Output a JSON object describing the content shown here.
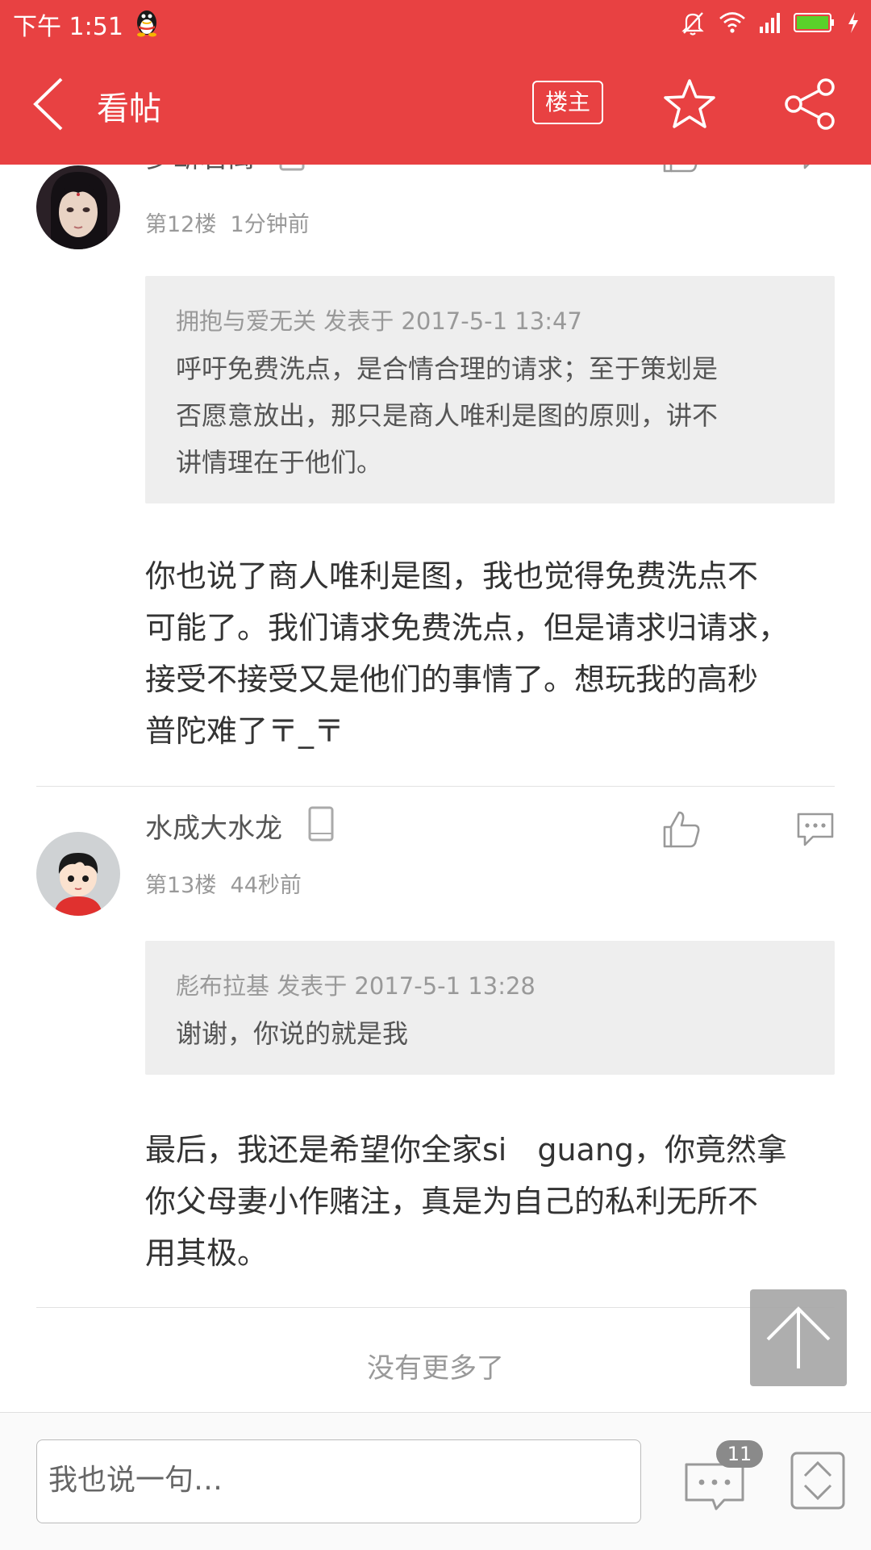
{
  "status_bar": {
    "time": "下午 1:51",
    "icons": [
      "qq-icon",
      "bell-off-icon",
      "wifi-icon",
      "signal-icon",
      "battery-icon",
      "charging-icon"
    ],
    "battery_color": "#5ad12a"
  },
  "app_bar": {
    "title": "看帖",
    "op_label": "楼主",
    "bg_color": "#e84142",
    "icons": [
      "back-icon",
      "star-icon",
      "share-icon"
    ]
  },
  "posts": [
    {
      "username": "梦断君离",
      "floor": "第12楼",
      "time": "1分钟前",
      "quote_meta": "拥抱与爱无关 发表于 2017-5-1 13:47",
      "quote_lines": [
        "呼吁免费洗点，是合情合理的请求；至于策划是",
        "否愿意放出，那只是商人唯利是图的原则，讲不",
        "讲情理在于他们。"
      ],
      "body_lines": [
        "你也说了商人唯利是图，我也觉得免费洗点不",
        "可能了。我们请求免费洗点，但是请求归请求，",
        "接受不接受又是他们的事情了。想玩我的高秒",
        "普陀难了〒_〒"
      ]
    },
    {
      "username": "水成大水龙",
      "floor": "第13楼",
      "time": "44秒前",
      "quote_meta": "彪布拉基 发表于 2017-5-1 13:28",
      "quote_lines": [
        "谢谢，你说的就是我"
      ],
      "body_lines": [
        "最后，我还是希望你全家si　guang，你竟然拿",
        "你父母妻小作赌注，真是为自己的私利无所不",
        "用其极。"
      ]
    }
  ],
  "footer": {
    "no_more": "没有更多了"
  },
  "bottom_bar": {
    "input_placeholder": "我也说一句…",
    "comment_count": "11"
  }
}
